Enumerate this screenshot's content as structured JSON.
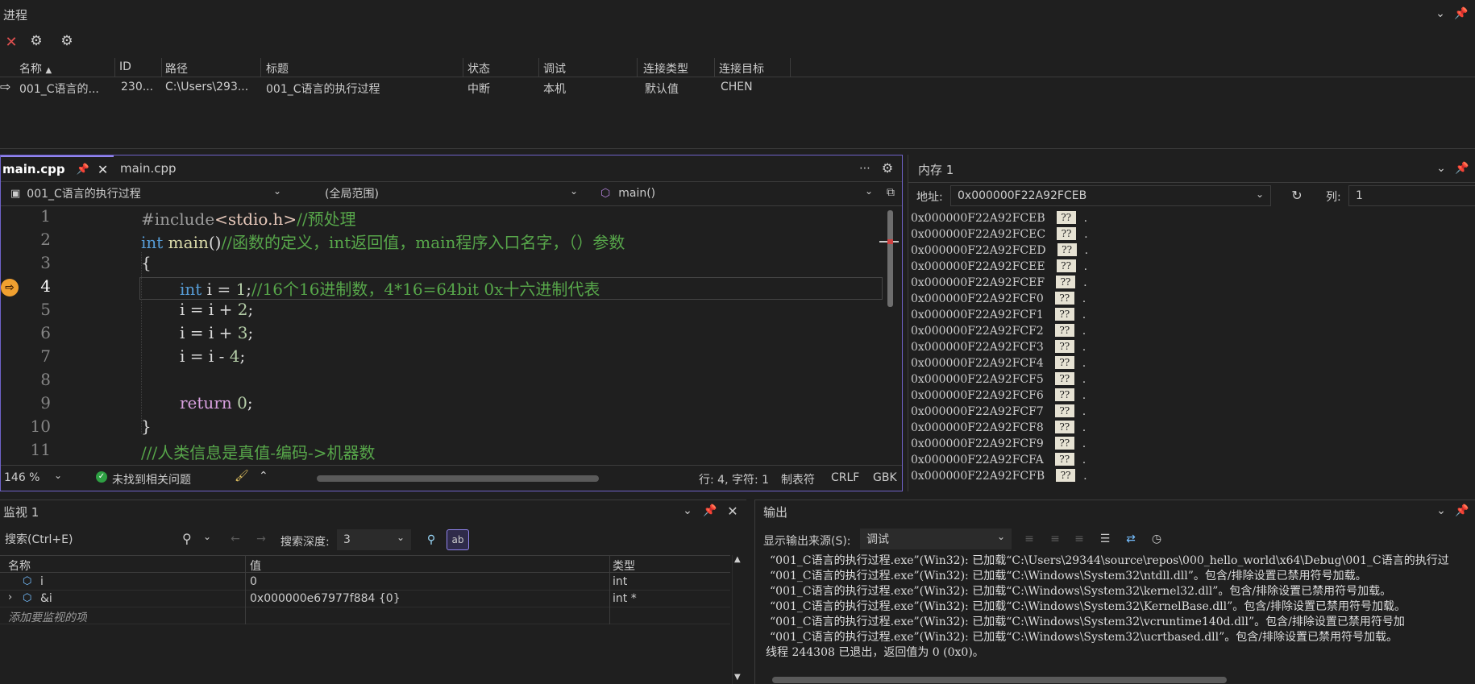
{
  "process_panel": {
    "title": "进程",
    "columns": [
      "名称",
      "ID",
      "路径",
      "标题",
      "状态",
      "调试",
      "连接类型",
      "连接目标"
    ],
    "row": {
      "name": "001_C语言的...",
      "id": "230...",
      "path": "C:\\Users\\293...",
      "title": "001_C语言的执行过程",
      "state": "中断",
      "debug": "本机",
      "conn_type": "默认值",
      "conn_target": "CHEN"
    }
  },
  "editor": {
    "tabs": [
      {
        "label": "main.cpp",
        "active": true
      },
      {
        "label": "main.cpp",
        "active": false
      }
    ],
    "project_dropdown": "001_C语言的执行过程",
    "scope_dropdown": "(全局范围)",
    "func_dropdown": "main()",
    "line_numbers": [
      "1",
      "2",
      "3",
      "4",
      "5",
      "6",
      "7",
      "8",
      "9",
      "10",
      "11"
    ],
    "code": {
      "l1_a": "#include",
      "l1_b": "<stdio.h>",
      "l1_c": "//预处理",
      "l2_a": "int",
      "l2_b": " main",
      "l2_c": "()",
      "l2_d": "//函数的定义，int返回值，main程序入口名字，（）参数",
      "l3": "{",
      "l4_a": "int",
      "l4_b": " i = ",
      "l4_c": "1",
      "l4_d": ";",
      "l4_e": "//16个16进制数，4*16=64bit 0x十六进制代表",
      "l5_a": "i = i + ",
      "l5_b": "2",
      "l5_c": ";",
      "l6_a": "i = i + ",
      "l6_b": "3",
      "l6_c": ";",
      "l7_a": "i = i - ",
      "l7_b": "4",
      "l7_c": ";",
      "l9_a": "return",
      "l9_b": " ",
      "l9_c": "0",
      "l9_d": ";",
      "l10": "}",
      "l11": "///人类信息是真值-编码->机器数"
    },
    "status": {
      "zoom": "146 %",
      "issues": "未找到相关问题",
      "position": "行: 4, 字符: 1",
      "indent": "制表符",
      "eol": "CRLF",
      "encoding": "GBK"
    }
  },
  "memory_panel": {
    "title": "内存 1",
    "address_label": "地址:",
    "address_value": "0x000000F22A92FCEB",
    "columns_label": "列:",
    "columns_value": "1",
    "cell_value": "??",
    "dot": ".",
    "rows": [
      "0x000000F22A92FCEB",
      "0x000000F22A92FCEC",
      "0x000000F22A92FCED",
      "0x000000F22A92FCEE",
      "0x000000F22A92FCEF",
      "0x000000F22A92FCF0",
      "0x000000F22A92FCF1",
      "0x000000F22A92FCF2",
      "0x000000F22A92FCF3",
      "0x000000F22A92FCF4",
      "0x000000F22A92FCF5",
      "0x000000F22A92FCF6",
      "0x000000F22A92FCF7",
      "0x000000F22A92FCF8",
      "0x000000F22A92FCF9",
      "0x000000F22A92FCFA",
      "0x000000F22A92FCFB"
    ]
  },
  "watch_panel": {
    "title": "监视 1",
    "search_placeholder": "搜索(Ctrl+E)",
    "depth_label": "搜索深度:",
    "depth_value": "3",
    "columns": [
      "名称",
      "值",
      "类型"
    ],
    "rows": [
      {
        "name": "i",
        "value": "0",
        "type": "int"
      },
      {
        "name": "&i",
        "value": "0x000000e67977f884 {0}",
        "type": "int *"
      }
    ],
    "add_hint": "添加要监视的项"
  },
  "output_panel": {
    "title": "输出",
    "source_label": "显示输出来源(S):",
    "source_value": "调试",
    "lines": [
      "“001_C语言的执行过程.exe”(Win32): 已加载“C:\\Users\\29344\\source\\repos\\000_hello_world\\x64\\Debug\\001_C语言的执行过",
      "“001_C语言的执行过程.exe”(Win32): 已加载“C:\\Windows\\System32\\ntdll.dll”。包含/排除设置已禁用符号加载。",
      "“001_C语言的执行过程.exe”(Win32): 已加载“C:\\Windows\\System32\\kernel32.dll”。包含/排除设置已禁用符号加载。",
      "“001_C语言的执行过程.exe”(Win32): 已加载“C:\\Windows\\System32\\KernelBase.dll”。包含/排除设置已禁用符号加载。",
      "“001_C语言的执行过程.exe”(Win32): 已加载“C:\\Windows\\System32\\vcruntime140d.dll”。包含/排除设置已禁用符号加",
      "“001_C语言的执行过程.exe”(Win32): 已加载“C:\\Windows\\System32\\ucrtbased.dll”。包含/排除设置已禁用符号加载。",
      "线程 244308 已退出，返回值为 0 (0x0)。"
    ]
  },
  "colors": {
    "accent": "#9184ee",
    "background": "#1f1f1f",
    "breakpoint_arrow": "#f0a030"
  }
}
